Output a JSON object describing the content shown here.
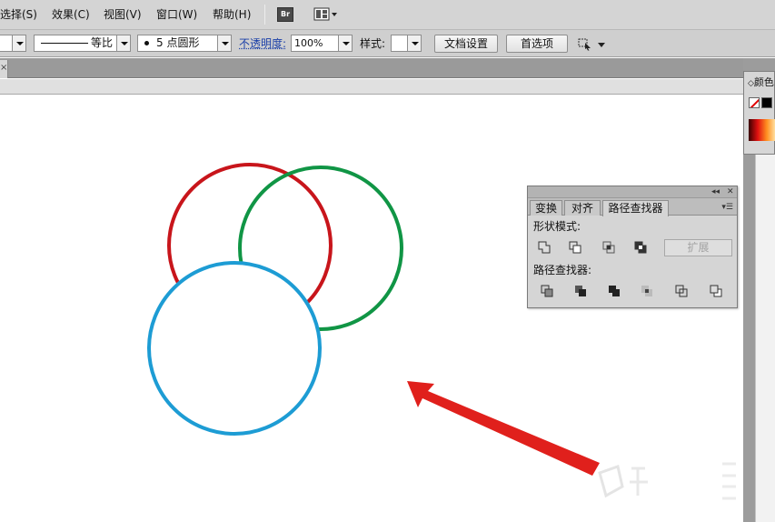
{
  "menubar": {
    "items": [
      {
        "label": "选择(S)"
      },
      {
        "label": "效果(C)"
      },
      {
        "label": "视图(V)"
      },
      {
        "label": "窗口(W)"
      },
      {
        "label": "帮助(H)"
      }
    ],
    "bridge_label": "Br"
  },
  "controlbar": {
    "stroke_profile": "等比",
    "brush_value": "5 点圆形",
    "opacity_label": "不透明度:",
    "opacity_value": "100%",
    "style_label": "样式:",
    "doc_setup_button": "文档设置",
    "preferences_button": "首选项"
  },
  "color_panel": {
    "title": "颜色"
  },
  "pathfinder_panel": {
    "tabs": [
      {
        "label": "变换"
      },
      {
        "label": "对齐"
      },
      {
        "label": "路径查找器"
      }
    ],
    "active_tab": "路径查找器",
    "shape_modes_label": "形状模式:",
    "expand_button": "扩展",
    "pathfinders_label": "路径查找器:"
  },
  "canvas": {
    "shapes": [
      {
        "name": "red-circle",
        "stroke": "#c8151b"
      },
      {
        "name": "green-circle",
        "stroke": "#109545"
      },
      {
        "name": "blue-circle",
        "stroke": "#1d9cd4"
      }
    ],
    "arrow_color": "#e0201c"
  },
  "colors": {
    "menubar_bg": "#d4d4d4",
    "panel_bg": "#d5d5d5",
    "link_blue": "#1a3fa8"
  }
}
